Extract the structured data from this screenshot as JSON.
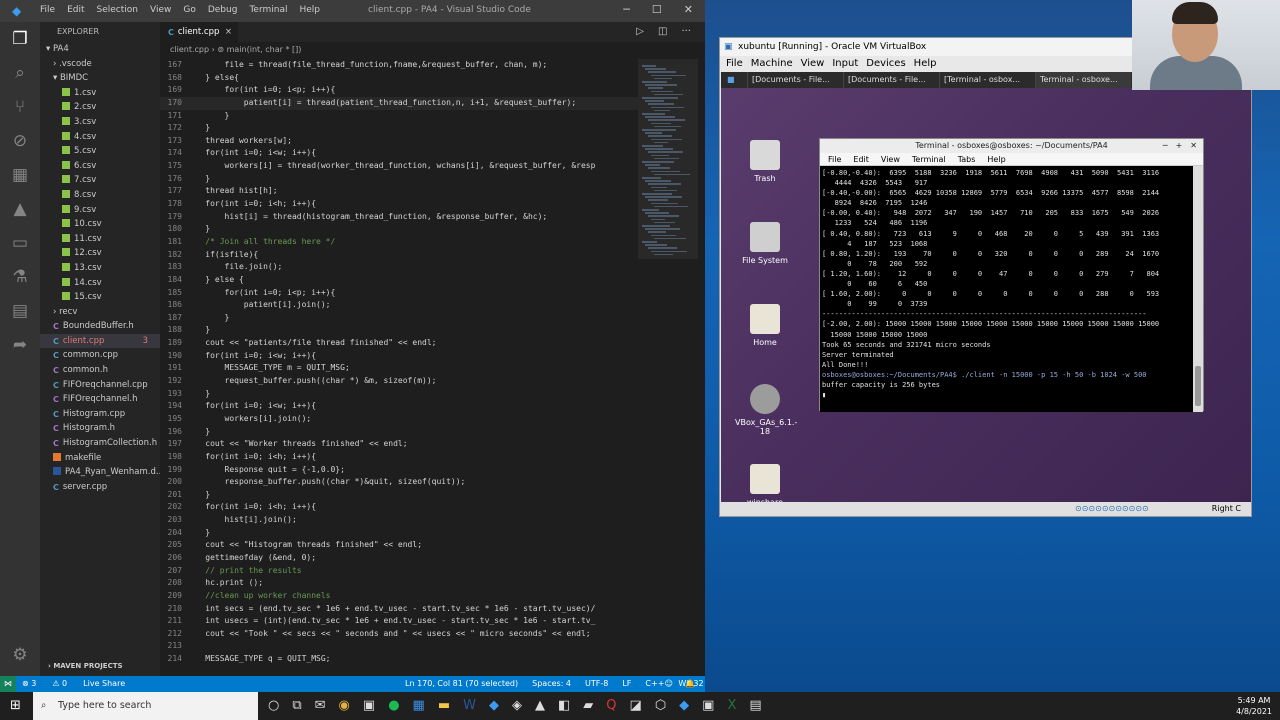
{
  "vscode": {
    "menu": [
      "File",
      "Edit",
      "Selection",
      "View",
      "Go",
      "Debug",
      "Terminal",
      "Help"
    ],
    "title": "client.cpp - PA4 - Visual Studio Code",
    "explorer_label": "EXPLORER",
    "root": "PA4",
    "files": [
      {
        "name": "vscode",
        "label": ".vscode",
        "type": "folder",
        "indent": 1
      },
      {
        "name": "bimdc",
        "label": "BIMDC",
        "type": "folder-open",
        "indent": 1
      },
      {
        "name": "1csv",
        "label": "1.csv",
        "type": "csv",
        "indent": 2
      },
      {
        "name": "2csv",
        "label": "2.csv",
        "type": "csv",
        "indent": 2
      },
      {
        "name": "3csv",
        "label": "3.csv",
        "type": "csv",
        "indent": 2
      },
      {
        "name": "4csv",
        "label": "4.csv",
        "type": "csv",
        "indent": 2
      },
      {
        "name": "5csv",
        "label": "5.csv",
        "type": "csv",
        "indent": 2
      },
      {
        "name": "6csv",
        "label": "6.csv",
        "type": "csv",
        "indent": 2
      },
      {
        "name": "7csv",
        "label": "7.csv",
        "type": "csv",
        "indent": 2
      },
      {
        "name": "8csv",
        "label": "8.csv",
        "type": "csv",
        "indent": 2
      },
      {
        "name": "9csv",
        "label": "9.csv",
        "type": "csv",
        "indent": 2
      },
      {
        "name": "10csv",
        "label": "10.csv",
        "type": "csv",
        "indent": 2
      },
      {
        "name": "11csv",
        "label": "11.csv",
        "type": "csv",
        "indent": 2
      },
      {
        "name": "12csv",
        "label": "12.csv",
        "type": "csv",
        "indent": 2
      },
      {
        "name": "13csv",
        "label": "13.csv",
        "type": "csv",
        "indent": 2
      },
      {
        "name": "14csv",
        "label": "14.csv",
        "type": "csv",
        "indent": 2
      },
      {
        "name": "15csv",
        "label": "15.csv",
        "type": "csv",
        "indent": 2
      },
      {
        "name": "recv",
        "label": "recv",
        "type": "folder",
        "indent": 1
      },
      {
        "name": "boundedbuffer-h",
        "label": "BoundedBuffer.h",
        "type": "h",
        "indent": 1
      },
      {
        "name": "client-cpp",
        "label": "client.cpp",
        "type": "cpp",
        "indent": 1,
        "selected": true,
        "badge": "3"
      },
      {
        "name": "common-cpp",
        "label": "common.cpp",
        "type": "cpp",
        "indent": 1
      },
      {
        "name": "common-h",
        "label": "common.h",
        "type": "h",
        "indent": 1
      },
      {
        "name": "fiforeqchannel-cpp",
        "label": "FIFOreqchannel.cpp",
        "type": "cpp",
        "indent": 1
      },
      {
        "name": "fiforeqchannel-h",
        "label": "FIFOreqchannel.h",
        "type": "h",
        "indent": 1
      },
      {
        "name": "histogram-cpp",
        "label": "Histogram.cpp",
        "type": "cpp",
        "indent": 1
      },
      {
        "name": "histogram-h",
        "label": "Histogram.h",
        "type": "h",
        "indent": 1
      },
      {
        "name": "histogramcollection-h",
        "label": "HistogramCollection.h",
        "type": "h",
        "indent": 1
      },
      {
        "name": "makefile",
        "label": "makefile",
        "type": "mk",
        "indent": 1
      },
      {
        "name": "pa4-doc",
        "label": "PA4_Ryan_Wenham.d...",
        "type": "doc",
        "indent": 1
      },
      {
        "name": "server-cpp",
        "label": "server.cpp",
        "type": "cpp",
        "indent": 1
      }
    ],
    "maven_label": "MAVEN PROJECTS",
    "tab_label": "client.cpp",
    "breadcrumb": [
      "client.cpp",
      "main(int, char * [])"
    ],
    "code": [
      {
        "n": "167",
        "t": "        file = thread(file_thread_function,fname,&request_buffer, chan, m);"
      },
      {
        "n": "168",
        "t": "    } else{"
      },
      {
        "n": "169",
        "t": "        for(int i=0; i<p; i++){"
      },
      {
        "n": "170",
        "t": "            patient[i] = thread(patient_thread_function,n, i+1, &request_buffer);",
        "cur": true
      },
      {
        "n": "171",
        "t": "        }"
      },
      {
        "n": "172",
        "t": "    }"
      },
      {
        "n": "173",
        "t": "    thread workers[w];"
      },
      {
        "n": "174",
        "t": "    for(int i=0; i<w; i++){"
      },
      {
        "n": "175",
        "t": "        workers[i] = thread(worker_thread_function, wchans[i], &request_buffer, &resp"
      },
      {
        "n": "176",
        "t": "    }"
      },
      {
        "n": "177",
        "t": "    thread hist[h];"
      },
      {
        "n": "178",
        "t": "    for(int i=0; i<h; i++){"
      },
      {
        "n": "179",
        "t": "        hist[i] = thread(histogram_thread_function, &response_buffer, &hc);"
      },
      {
        "n": "180",
        "t": "    }"
      },
      {
        "n": "181",
        "t": "    /* Join all threads here */",
        "com": true
      },
      {
        "n": "182",
        "t": "    if(isfile){"
      },
      {
        "n": "183",
        "t": "        file.join();"
      },
      {
        "n": "184",
        "t": "    } else {"
      },
      {
        "n": "185",
        "t": "        for(int i=0; i<p; i++){"
      },
      {
        "n": "186",
        "t": "            patient[i].join();"
      },
      {
        "n": "187",
        "t": "        }"
      },
      {
        "n": "188",
        "t": "    }"
      },
      {
        "n": "189",
        "t": "    cout << \"patients/file thread finished\" << endl;"
      },
      {
        "n": "190",
        "t": "    for(int i=0; i<w; i++){"
      },
      {
        "n": "191",
        "t": "        MESSAGE_TYPE m = QUIT_MSG;"
      },
      {
        "n": "192",
        "t": "        request_buffer.push((char *) &m, sizeof(m));"
      },
      {
        "n": "193",
        "t": "    }"
      },
      {
        "n": "194",
        "t": "    for(int i=0; i<w; i++){"
      },
      {
        "n": "195",
        "t": "        workers[i].join();"
      },
      {
        "n": "196",
        "t": "    }"
      },
      {
        "n": "197",
        "t": "    cout << \"Worker threads finished\" << endl;"
      },
      {
        "n": "198",
        "t": "    for(int i=0; i<h; i++){"
      },
      {
        "n": "199",
        "t": "        Response quit = {-1,0.0};"
      },
      {
        "n": "200",
        "t": "        response_buffer.push((char *)&quit, sizeof(quit));"
      },
      {
        "n": "201",
        "t": "    }"
      },
      {
        "n": "202",
        "t": "    for(int i=0; i<h; i++){"
      },
      {
        "n": "203",
        "t": "        hist[i].join();"
      },
      {
        "n": "204",
        "t": "    }"
      },
      {
        "n": "205",
        "t": "    cout << \"Histogram threads finished\" << endl;"
      },
      {
        "n": "206",
        "t": "    gettimeofday (&end, 0);"
      },
      {
        "n": "207",
        "t": "    // print the results",
        "com": true
      },
      {
        "n": "208",
        "t": "    hc.print ();"
      },
      {
        "n": "209",
        "t": "    //clean up worker channels",
        "com": true
      },
      {
        "n": "210",
        "t": "    int secs = (end.tv_sec * 1e6 + end.tv_usec - start.tv_sec * 1e6 - start.tv_usec)/"
      },
      {
        "n": "211",
        "t": "    int usecs = (int)(end.tv_sec * 1e6 + end.tv_usec - start.tv_sec * 1e6 - start.tv_"
      },
      {
        "n": "212",
        "t": "    cout << \"Took \" << secs << \" seconds and \" << usecs << \" micro seconds\" << endl;"
      },
      {
        "n": "213",
        "t": ""
      },
      {
        "n": "214",
        "t": "    MESSAGE_TYPE q = QUIT_MSG;"
      }
    ],
    "status": {
      "errors": "⊗ 3",
      "warnings": "⚠ 0",
      "live_share": "Live Share",
      "position": "Ln 170, Col 81 (70 selected)",
      "spaces": "Spaces: 4",
      "encoding": "UTF-8",
      "eol": "LF",
      "lang": "C++",
      "platform": "Win32"
    }
  },
  "virtualbox": {
    "title": "xubuntu [Running] - Oracle VM VirtualBox",
    "menu": [
      "File",
      "Machine",
      "View",
      "Input",
      "Devices",
      "Help"
    ],
    "tasks": [
      "[Documents - File...",
      "[Documents - File...",
      "[Terminal - osbox...",
      "Terminal - osboxe..."
    ],
    "desktop_icons": [
      {
        "name": "trash",
        "label": "Trash",
        "color": "#d9d9d9"
      },
      {
        "name": "file-system",
        "label": "File System",
        "color": "#cfcfcf"
      },
      {
        "name": "home",
        "label": "Home",
        "color": "#e9e4d6"
      },
      {
        "name": "vbox-cd",
        "label": "VBox_GAs_6.1.-\n18",
        "color": "#9c9c9c"
      },
      {
        "name": "winshare",
        "label": "winshare",
        "color": "#e9e4d6"
      }
    ],
    "status_right": "Right C",
    "terminal": {
      "title": "Terminal - osboxes@osboxes: ~/Documents/PA4",
      "menu": [
        "File",
        "Edit",
        "View",
        "Terminal",
        "Tabs",
        "Help"
      ],
      "lines": [
        "[-0.80,-0.40):  6395  5188  3236  1918  5611  7698  4908   431  5090  5431  3116",
        "   4444  4326  5543   917",
        "[-0.40,-0.00):  6565  4629 10358 12869  5779  6534  9266 13375  4577  8598  2144",
        "   8924  8426  7195  1246",
        "[-0.00, 0.40):   948  2072   347   190  1457   710   205   833  1675   549  2026",
        "   1233   524   486  1196",
        "[ 0.40, 0.80):   723   613     9     0   468    20     0     5   439   391  1363",
        "      4   187   523  1068",
        "[ 0.80, 1.20):   193    70     0     0   320     0     0     0   289    24  1670",
        "      0    78   200   592",
        "[ 1.20, 1.60):    12     0     0     0    47     0     0     0   279     7   804",
        "      0    60     6   450",
        "[ 1.60, 2.00):     0     0     0     0     0     0     0     0   288     0   593",
        "      0    99     0  3739",
        "",
        "-----------------------------------------------------------------------------",
        "[-2.00, 2.00): 15000 15000 15000 15000 15000 15000 15000 15000 15000 15000 15000",
        "  15000 15000 15000 15000",
        "Took 65 seconds and 321741 micro seconds",
        "Server terminated",
        "All Done!!!",
        "osboxes@osboxes:~/Documents/PA4$ ./client -n 15000 -p 15 -h 50 -b 1024 -w 500",
        "buffer capacity is 256 bytes",
        "▮"
      ]
    }
  },
  "taskbar": {
    "search_placeholder": "Type here to search",
    "time": "5:49 AM",
    "date": "4/8/2021"
  }
}
